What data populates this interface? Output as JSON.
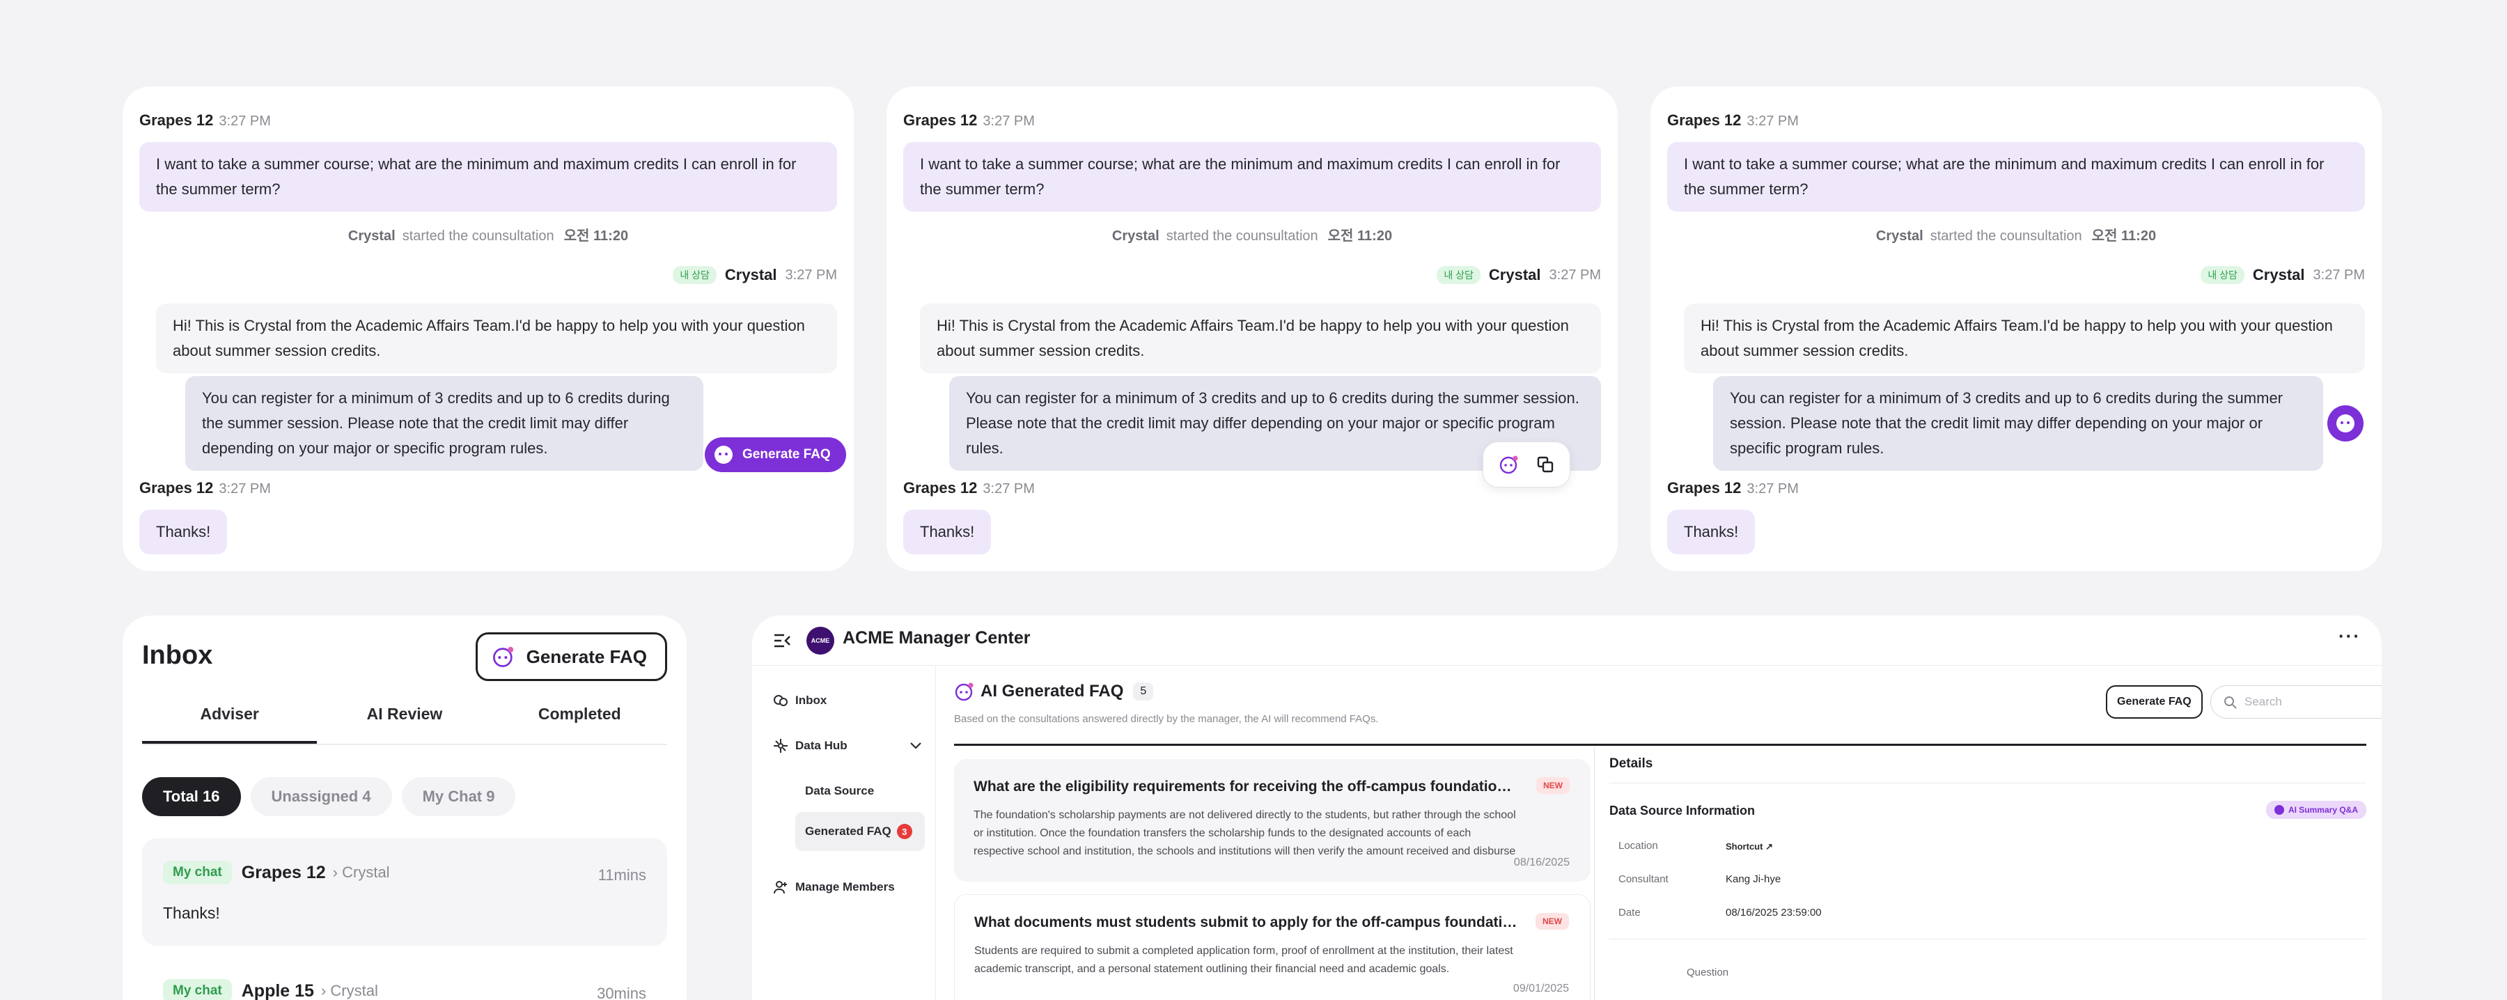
{
  "chat": {
    "user_name": "Grapes 12",
    "time": "3:27 PM",
    "user_message": "I want to take a summer course; what are the minimum and maximum credits I can enroll in for the summer term?",
    "system": {
      "name": "Crystal",
      "text": "started the counsultation",
      "time": "오전 11:20"
    },
    "agent_badge": "내 상담",
    "agent_name": "Crystal",
    "agent_message_1": "Hi! This is Crystal from the Academic Affairs Team.I'd be happy to help you with your question about summer session credits.",
    "agent_message_2": "You can register for a minimum of 3 credits and up to 6 credits during the summer session. Please note that the credit limit may differ depending on your major or specific program rules.",
    "reply": "Thanks!",
    "generate_faq_label": "Generate FAQ"
  },
  "inbox": {
    "title": "Inbox",
    "generate_faq_label": "Generate FAQ",
    "tabs": [
      "Adviser",
      "AI Review",
      "Completed"
    ],
    "chips": [
      "Total 16",
      "Unassigned 4",
      "My Chat 9"
    ],
    "rows": [
      {
        "badge": "My chat",
        "name": "Grapes 12",
        "assignee": "Crystal",
        "time": "11mins",
        "message": "Thanks!"
      },
      {
        "badge": "My chat",
        "name": "Apple 15",
        "assignee": "Crystal",
        "time": "30mins"
      }
    ]
  },
  "acme": {
    "app_title": "ACME Manager Center",
    "logo_text": "ACME",
    "nav": {
      "inbox": "Inbox",
      "data_hub": "Data Hub",
      "data_source": "Data Source",
      "generated_faq": "Generated FAQ",
      "generated_faq_count": "3",
      "manage_members": "Manage Members"
    },
    "header": {
      "title": "AI Generated FAQ",
      "count": "5",
      "subtitle": "Based on the consultations answered directly by the manager, the AI will recommend FAQs.",
      "generate_faq_label": "Generate FAQ",
      "search_placeholder": "Search"
    },
    "faqs": [
      {
        "question": "What are the eligibility requirements for receiving the off-campus foundation scholarship?",
        "answer": "The foundation's scholarship payments are not delivered directly to the students, but rather through the school or institution. Once the foundation transfers the scholarship funds to the designated accounts of each respective school and institution, the schools and institutions will then verify the amount received and disburse it to the students.",
        "badge": "NEW",
        "date": "08/16/2025"
      },
      {
        "question": "What documents must students submit to apply for the off-campus foundation scholarship?",
        "answer": "Students are required to submit a completed application form, proof of enrollment at the institution, their latest academic transcript, and a personal statement outlining their financial need and academic goals.",
        "badge": "NEW",
        "date": "09/01/2025"
      }
    ],
    "details": {
      "title": "Details",
      "section": "Data Source Information",
      "badge": "AI Summary Q&A",
      "location_label": "Location",
      "location_value": "Shortcut",
      "consultant_label": "Consultant",
      "consultant_value": "Kang Ji-hye",
      "date_label": "Date",
      "date_value": "08/16/2025 23:59:00",
      "question_label": "Question"
    }
  },
  "colors": {
    "accent": "#7d2fd8",
    "user_bubble": "#efe8fb",
    "badge_green": "#2f9c4e",
    "new_red": "#e04848"
  }
}
